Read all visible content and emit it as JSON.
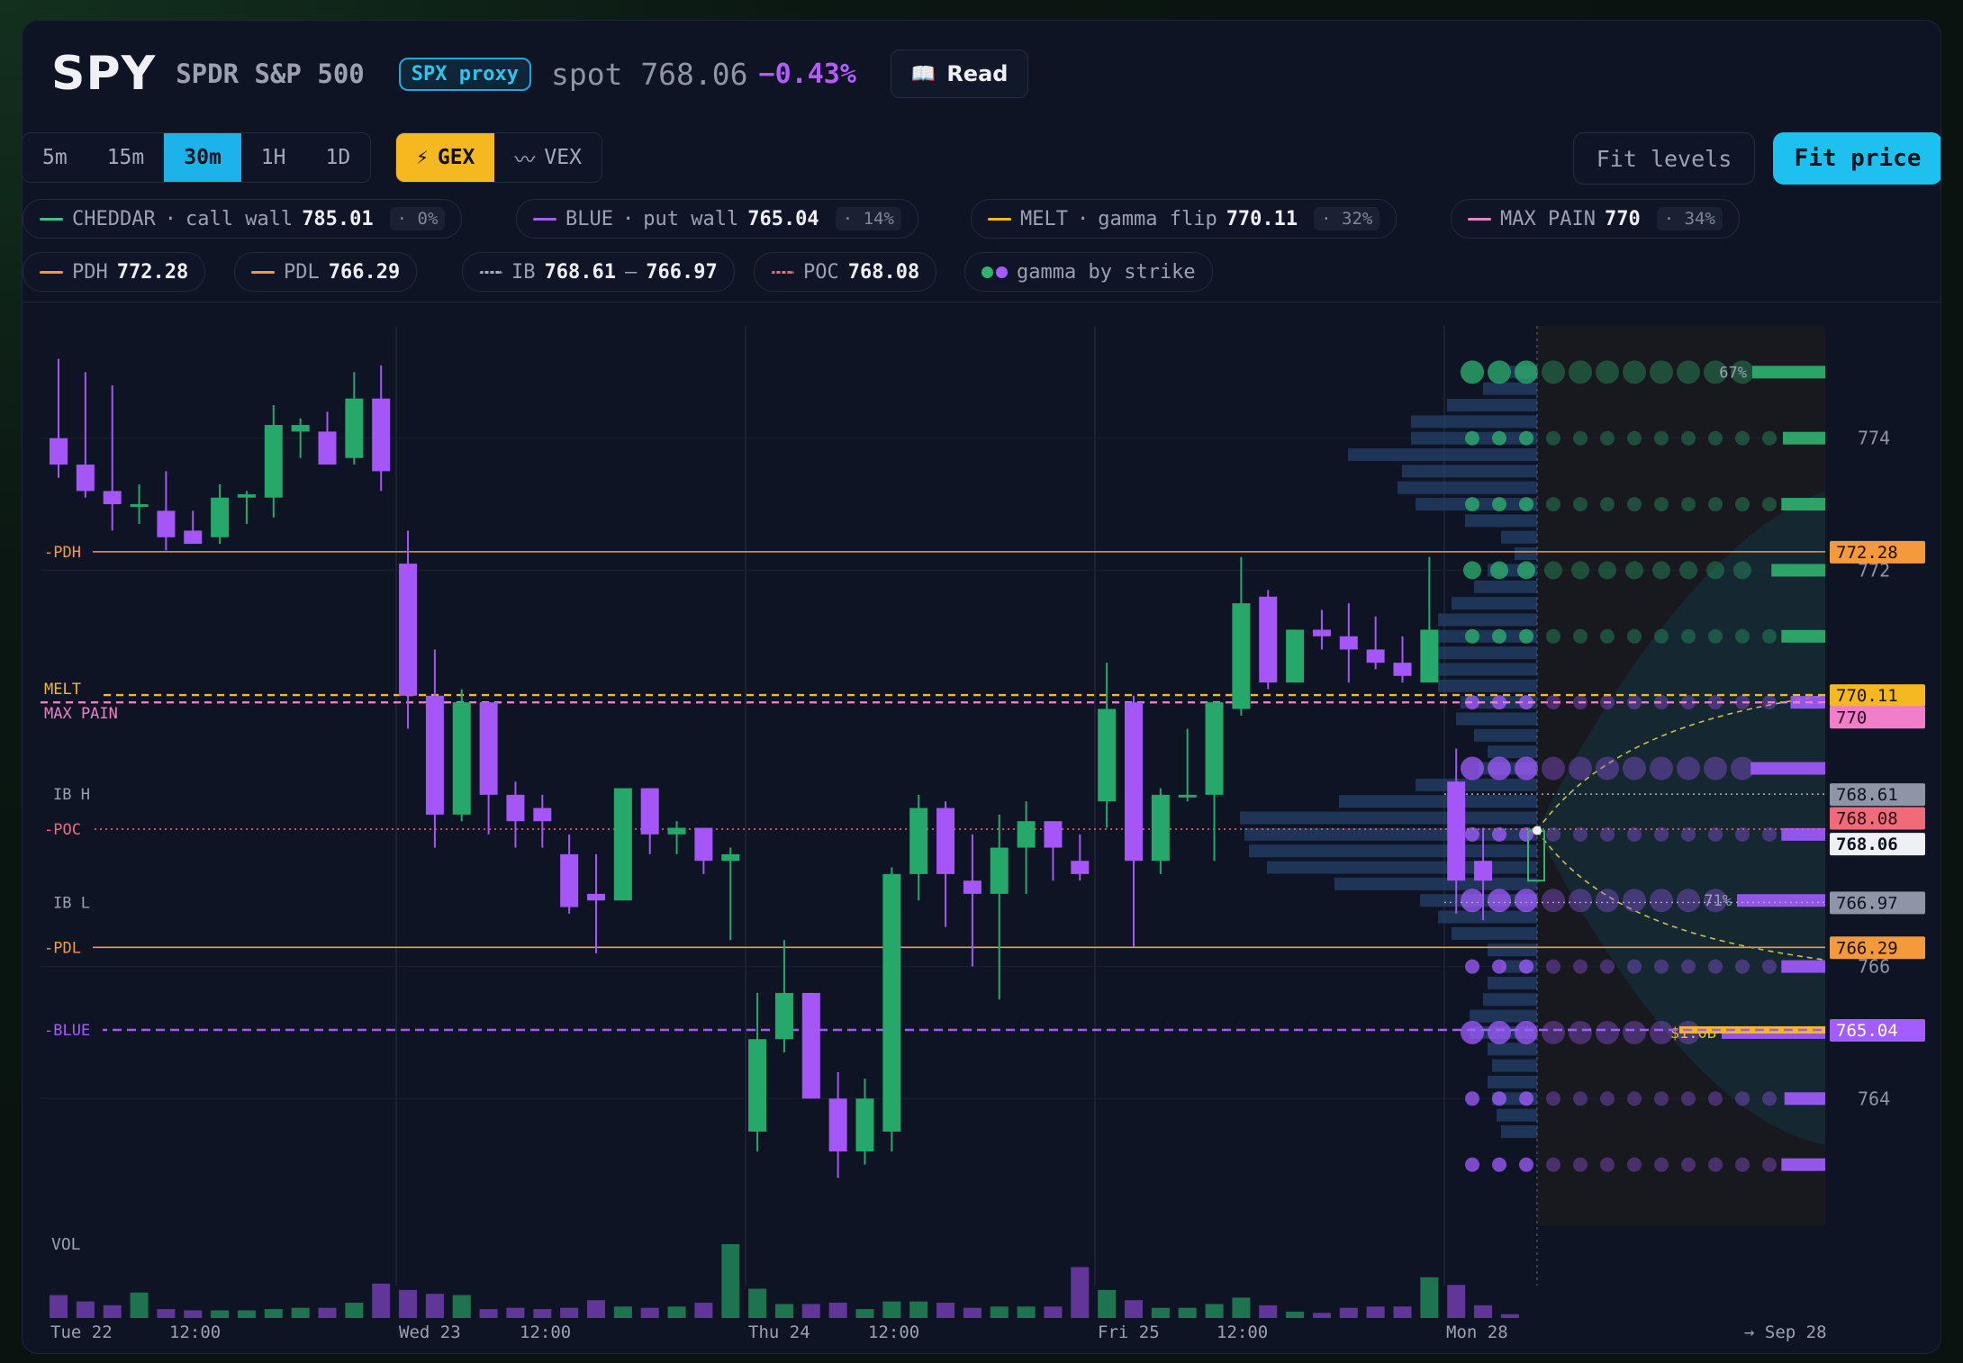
{
  "header": {
    "ticker": "SPY",
    "name": "SPDR S&P 500",
    "proxy_badge": "SPX proxy",
    "spot_label": "spot",
    "spot_value": "768.06",
    "change": "−0.43%",
    "read_label": "Read",
    "read_icon": "book-icon"
  },
  "toolbar": {
    "timeframes": [
      "5m",
      "15m",
      "30m",
      "1H",
      "1D"
    ],
    "active_timeframe": "30m",
    "modes": [
      {
        "icon": "lightning-icon",
        "glyph": "⚡",
        "label": "GEX",
        "active": true
      },
      {
        "icon": "wave-icon",
        "glyph": "〰",
        "label": "VEX",
        "active": false
      }
    ],
    "fit_levels": "Fit levels",
    "fit_price": "Fit price"
  },
  "levels_row1": [
    {
      "name": "CHEDDAR",
      "desc": "call wall",
      "value": "785.01",
      "pct": "· 0%",
      "color": "#3cc48a"
    },
    {
      "name": "BLUE",
      "desc": "put wall",
      "value": "765.04",
      "pct": "· 14%",
      "color": "#a25cff"
    },
    {
      "name": "MELT",
      "desc": "gamma flip",
      "value": "770.11",
      "pct": "· 32%",
      "color": "#f5b820"
    },
    {
      "name": "MAX PAIN",
      "desc": "",
      "value": "770",
      "pct": "· 34%",
      "color": "#f07ec8"
    }
  ],
  "levels_row2": [
    {
      "name": "PDH",
      "value": "772.28",
      "color": "#f59a3c"
    },
    {
      "name": "PDL",
      "value": "766.29",
      "color": "#f59a3c"
    },
    {
      "name": "IB",
      "value": "768.61",
      "value2": "766.97",
      "sep": "–",
      "color": "#aab0bf"
    },
    {
      "name": "POC",
      "value": "768.08",
      "color": "#f06b7a"
    },
    {
      "name": "gamma by strike"
    }
  ],
  "chart_data": {
    "type": "candlestick",
    "y_range": [
      762.6,
      775.7
    ],
    "y_ticks": [
      774,
      772,
      766,
      764
    ],
    "x_labels": [
      "Tue 22",
      "12:00",
      "Wed 23",
      "12:00",
      "Thu 24",
      "12:00",
      "Fri 25",
      "12:00",
      "Mon 28",
      "→ Sep 28"
    ],
    "volume_label": "VOL",
    "candles": [
      {
        "o": 774.0,
        "h": 775.2,
        "l": 773.4,
        "c": 773.6
      },
      {
        "o": 773.6,
        "h": 775.0,
        "l": 773.1,
        "c": 773.2
      },
      {
        "o": 773.2,
        "h": 774.8,
        "l": 772.6,
        "c": 773.0
      },
      {
        "o": 773.0,
        "h": 773.3,
        "l": 772.7,
        "c": 773.0
      },
      {
        "o": 772.9,
        "h": 773.5,
        "l": 772.3,
        "c": 772.5
      },
      {
        "o": 772.6,
        "h": 772.9,
        "l": 772.4,
        "c": 772.4
      },
      {
        "o": 772.5,
        "h": 773.3,
        "l": 772.4,
        "c": 773.1
      },
      {
        "o": 773.1,
        "h": 773.2,
        "l": 772.7,
        "c": 773.15
      },
      {
        "o": 773.1,
        "h": 774.5,
        "l": 772.8,
        "c": 774.2
      },
      {
        "o": 774.1,
        "h": 774.3,
        "l": 773.7,
        "c": 774.2
      },
      {
        "o": 774.1,
        "h": 774.4,
        "l": 773.7,
        "c": 773.6
      },
      {
        "o": 773.7,
        "h": 775.0,
        "l": 773.6,
        "c": 774.6
      },
      {
        "o": 774.6,
        "h": 775.1,
        "l": 773.2,
        "c": 773.5
      },
      {
        "o": 772.1,
        "h": 772.6,
        "l": 769.6,
        "c": 770.1
      },
      {
        "o": 770.1,
        "h": 770.8,
        "l": 767.8,
        "c": 768.3
      },
      {
        "o": 768.3,
        "h": 770.2,
        "l": 768.2,
        "c": 770.0
      },
      {
        "o": 770.0,
        "h": 770.0,
        "l": 768.0,
        "c": 768.6
      },
      {
        "o": 768.6,
        "h": 768.8,
        "l": 767.8,
        "c": 768.2
      },
      {
        "o": 768.4,
        "h": 768.6,
        "l": 767.8,
        "c": 768.2
      },
      {
        "o": 767.7,
        "h": 768.0,
        "l": 766.8,
        "c": 766.9
      },
      {
        "o": 767.1,
        "h": 767.7,
        "l": 766.2,
        "c": 767.0
      },
      {
        "o": 767.0,
        "h": 768.7,
        "l": 767.0,
        "c": 768.7
      },
      {
        "o": 768.7,
        "h": 768.7,
        "l": 767.7,
        "c": 768.0
      },
      {
        "o": 768.0,
        "h": 768.2,
        "l": 767.7,
        "c": 768.1
      },
      {
        "o": 768.1,
        "h": 768.1,
        "l": 767.4,
        "c": 767.6
      },
      {
        "o": 767.6,
        "h": 767.8,
        "l": 766.4,
        "c": 767.7
      },
      {
        "o": 763.5,
        "h": 765.6,
        "l": 763.2,
        "c": 764.9
      },
      {
        "o": 764.9,
        "h": 766.4,
        "l": 764.7,
        "c": 765.6
      },
      {
        "o": 765.6,
        "h": 765.6,
        "l": 764.0,
        "c": 764.0
      },
      {
        "o": 764.0,
        "h": 764.4,
        "l": 762.8,
        "c": 763.2
      },
      {
        "o": 763.2,
        "h": 764.3,
        "l": 763.0,
        "c": 764.0
      },
      {
        "o": 763.5,
        "h": 767.5,
        "l": 763.2,
        "c": 767.4
      },
      {
        "o": 767.4,
        "h": 768.6,
        "l": 767.0,
        "c": 768.4
      },
      {
        "o": 768.4,
        "h": 768.5,
        "l": 766.6,
        "c": 767.4
      },
      {
        "o": 767.3,
        "h": 768.0,
        "l": 766.0,
        "c": 767.1
      },
      {
        "o": 767.1,
        "h": 768.3,
        "l": 765.5,
        "c": 767.8
      },
      {
        "o": 767.8,
        "h": 768.5,
        "l": 767.1,
        "c": 768.2
      },
      {
        "o": 768.2,
        "h": 768.2,
        "l": 767.3,
        "c": 767.8
      },
      {
        "o": 767.6,
        "h": 768.0,
        "l": 767.3,
        "c": 767.4
      },
      {
        "o": 768.5,
        "h": 770.6,
        "l": 768.1,
        "c": 769.9
      },
      {
        "o": 770.0,
        "h": 770.1,
        "l": 766.3,
        "c": 767.6
      },
      {
        "o": 767.6,
        "h": 768.7,
        "l": 767.4,
        "c": 768.6
      },
      {
        "o": 768.6,
        "h": 769.6,
        "l": 768.5,
        "c": 768.6
      },
      {
        "o": 768.6,
        "h": 770.0,
        "l": 767.6,
        "c": 770.0
      },
      {
        "o": 769.9,
        "h": 772.2,
        "l": 769.8,
        "c": 771.5
      },
      {
        "o": 771.6,
        "h": 771.7,
        "l": 770.2,
        "c": 770.3
      },
      {
        "o": 770.3,
        "h": 771.1,
        "l": 770.3,
        "c": 771.1
      },
      {
        "o": 771.1,
        "h": 771.4,
        "l": 770.8,
        "c": 771.0
      },
      {
        "o": 771.0,
        "h": 771.5,
        "l": 770.3,
        "c": 770.8
      },
      {
        "o": 770.8,
        "h": 771.3,
        "l": 770.5,
        "c": 770.6
      },
      {
        "o": 770.6,
        "h": 771.0,
        "l": 770.3,
        "c": 770.4
      },
      {
        "o": 770.3,
        "h": 772.2,
        "l": 770.3,
        "c": 771.1
      },
      {
        "o": 768.8,
        "h": 769.3,
        "l": 766.8,
        "c": 767.3
      },
      {
        "o": 767.6,
        "h": 768.1,
        "l": 766.7,
        "c": 767.3
      }
    ],
    "volumes": [
      18,
      13,
      10,
      20,
      7,
      6,
      6,
      6,
      7,
      8,
      8,
      12,
      27,
      22,
      19,
      18,
      7,
      8,
      7,
      8,
      14,
      9,
      8,
      9,
      12,
      58,
      23,
      11,
      11,
      12,
      7,
      13,
      13,
      12,
      8,
      9,
      9,
      9,
      40,
      22,
      14,
      8,
      8,
      11,
      16,
      10,
      5,
      4,
      8,
      9,
      9,
      32,
      26,
      10,
      3
    ],
    "bands": {
      "PDH": 772.28,
      "PDL": 766.29,
      "MELT": 770.11,
      "MAX_PAIN": 770.0,
      "BLUE": 765.04,
      "IB_H": 768.61,
      "IB_L": 766.97,
      "POC": 768.08
    },
    "band_labels": {
      "PDH": "PDH",
      "PDL": "PDL",
      "MELT": "MELT",
      "MAX_PAIN": "MAX PAIN",
      "BLUE": "BLUE",
      "IB_H": "IB H",
      "IB_L": "IB L",
      "POC": "POC"
    },
    "price_tags": [
      {
        "value": "772.28",
        "y": 772.28,
        "bg": "#f59a3c",
        "fg": "#1a0e00"
      },
      {
        "value": "770.11",
        "y": 770.11,
        "bg": "#f5b820",
        "fg": "#1a1400"
      },
      {
        "value": "770",
        "y": 769.78,
        "bg": "#f07ec8",
        "fg": "#2a0b1e"
      },
      {
        "value": "768.61",
        "y": 768.61,
        "bg": "#8e95a6",
        "fg": "#0d1220"
      },
      {
        "value": "768.08",
        "y": 768.25,
        "bg": "#f06b7a",
        "fg": "#2a0b10"
      },
      {
        "value": "768.06",
        "y": 767.86,
        "bg": "#eef0f5",
        "fg": "#0d1220"
      },
      {
        "value": "766.97",
        "y": 766.97,
        "bg": "#8e95a6",
        "fg": "#0d1220"
      },
      {
        "value": "766.29",
        "y": 766.29,
        "bg": "#f59a3c",
        "fg": "#1a0e00"
      },
      {
        "value": "765.04",
        "y": 765.04,
        "bg": "#a25cff",
        "fg": "#ffffff"
      }
    ],
    "gamma_strikes": [
      {
        "strike": 775,
        "value": 60,
        "sign": "pos",
        "pct": "67%"
      },
      {
        "strike": 774,
        "value": 20,
        "sign": "pos"
      },
      {
        "strike": 773,
        "value": 22,
        "sign": "pos"
      },
      {
        "strike": 772,
        "value": 35,
        "sign": "pos"
      },
      {
        "strike": 771,
        "value": 22,
        "sign": "pos"
      },
      {
        "strike": 770,
        "value": 10,
        "sign": "neg"
      },
      {
        "strike": 769,
        "value": 62,
        "sign": "neg"
      },
      {
        "strike": 768,
        "value": 22,
        "sign": "neg"
      },
      {
        "strike": 767,
        "value": 80,
        "sign": "neg",
        "pct": "71%"
      },
      {
        "strike": 766,
        "value": 22,
        "sign": "neg"
      },
      {
        "strike": 765,
        "value": 100,
        "sign": "neg",
        "pct": "$1.0B"
      },
      {
        "strike": 764,
        "value": 18,
        "sign": "neg"
      },
      {
        "strike": 763,
        "value": 22,
        "sign": "neg"
      }
    ],
    "volume_profile": [
      {
        "p": 775.0,
        "v": 30
      },
      {
        "p": 774.75,
        "v": 60
      },
      {
        "p": 774.5,
        "v": 100
      },
      {
        "p": 774.25,
        "v": 140
      },
      {
        "p": 774.0,
        "v": 140
      },
      {
        "p": 773.75,
        "v": 210
      },
      {
        "p": 773.5,
        "v": 150
      },
      {
        "p": 773.25,
        "v": 155
      },
      {
        "p": 773.0,
        "v": 135
      },
      {
        "p": 772.75,
        "v": 80
      },
      {
        "p": 772.5,
        "v": 40
      },
      {
        "p": 772.25,
        "v": 25
      },
      {
        "p": 772.0,
        "v": 55
      },
      {
        "p": 771.75,
        "v": 70
      },
      {
        "p": 771.5,
        "v": 95
      },
      {
        "p": 771.25,
        "v": 110
      },
      {
        "p": 771.0,
        "v": 110
      },
      {
        "p": 770.75,
        "v": 110
      },
      {
        "p": 770.5,
        "v": 110
      },
      {
        "p": 770.25,
        "v": 110
      },
      {
        "p": 770.0,
        "v": 85
      },
      {
        "p": 769.75,
        "v": 90
      },
      {
        "p": 769.5,
        "v": 70
      },
      {
        "p": 769.25,
        "v": 55
      },
      {
        "p": 769.0,
        "v": 65
      },
      {
        "p": 768.75,
        "v": 135
      },
      {
        "p": 768.5,
        "v": 220
      },
      {
        "p": 768.25,
        "v": 330
      },
      {
        "p": 768.0,
        "v": 325
      },
      {
        "p": 767.75,
        "v": 320
      },
      {
        "p": 767.5,
        "v": 300
      },
      {
        "p": 767.25,
        "v": 225
      },
      {
        "p": 767.0,
        "v": 130
      },
      {
        "p": 766.75,
        "v": 110
      },
      {
        "p": 766.5,
        "v": 95
      },
      {
        "p": 766.25,
        "v": 55
      },
      {
        "p": 766.0,
        "v": 40
      },
      {
        "p": 765.75,
        "v": 55
      },
      {
        "p": 765.5,
        "v": 60
      },
      {
        "p": 765.25,
        "v": 75
      },
      {
        "p": 765.0,
        "v": 75
      },
      {
        "p": 764.75,
        "v": 55
      },
      {
        "p": 764.5,
        "v": 50
      },
      {
        "p": 764.25,
        "v": 55
      },
      {
        "p": 764.0,
        "v": 50
      },
      {
        "p": 763.75,
        "v": 45
      },
      {
        "p": 763.5,
        "v": 40
      }
    ]
  }
}
